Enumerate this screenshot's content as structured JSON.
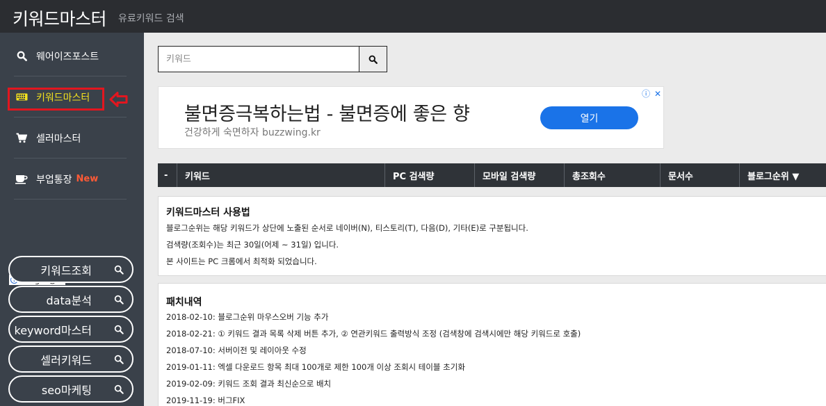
{
  "header": {
    "title": "키워드마스터",
    "subtitle": "유료키워드 검색"
  },
  "sidebar": {
    "items": [
      {
        "label": "웨어이즈포스트",
        "icon": "search-icon"
      },
      {
        "label": "키워드마스터",
        "icon": "keyboard-icon",
        "active": true
      },
      {
        "label": "셀러마스터",
        "icon": "cart-icon"
      },
      {
        "label": "부업통장",
        "icon": "coffee-icon",
        "badge": "New"
      }
    ],
    "ad_label": "Google 광고",
    "ad_links": [
      {
        "label": "키워드조회"
      },
      {
        "label": "data분석"
      },
      {
        "label": "keyword마스터"
      },
      {
        "label": "셀러키워드"
      },
      {
        "label": "seo마케팅"
      }
    ]
  },
  "search": {
    "placeholder": "키워드"
  },
  "ad_banner": {
    "title": "불면증극복하는법 - 불면증에 좋은 향",
    "url": "건강하게 숙면하자 buzzwing.kr",
    "button": "열기"
  },
  "table": {
    "columns": [
      "-",
      "키워드",
      "PC 검색량",
      "모바일 검색량",
      "총조회수",
      "문서수",
      "블로그순위 ▼"
    ]
  },
  "usage": {
    "title": "키워드마스터 사용법",
    "lines": [
      "블로그순위는 해당 키워드가 상단에 노출된 순서로 네이버(N), 티스토리(T), 다음(D), 기타(E)로 구분됩니다.",
      "검색량(조회수)는 최근 30일(어제 ~ 31일) 입니다.",
      "본 사이트는 PC 크롬에서 최적화 되었습니다."
    ]
  },
  "patch": {
    "title": "패치내역",
    "lines": [
      "2018-02-10: 블로그순위 마우스오버 기능 추가",
      "2018-02-21: ① 키워드 결과 목록 삭제 버튼 추가, ② 연관키워드 출력방식 조정 (검색창에 검색시에만 해당 키워드로 호출)",
      "2018-07-10: 서버이전 및 레이아웃 수정",
      "2019-01-11: 엑셀 다운로드 항목 최대 100개로 제한 100개 이상 조회시 테이블 초기화",
      "2019-02-09: 키워드 조회 결과 최신순으로 배치",
      "2019-11-19: 버그FIX"
    ]
  },
  "colors": {
    "topbar": "#2b2d31",
    "sidebar": "#3a414a",
    "active": "#f2e11e",
    "highlight_box": "#e3161f",
    "new_badge": "#ff5a36",
    "ad_button": "#1a73e8"
  }
}
